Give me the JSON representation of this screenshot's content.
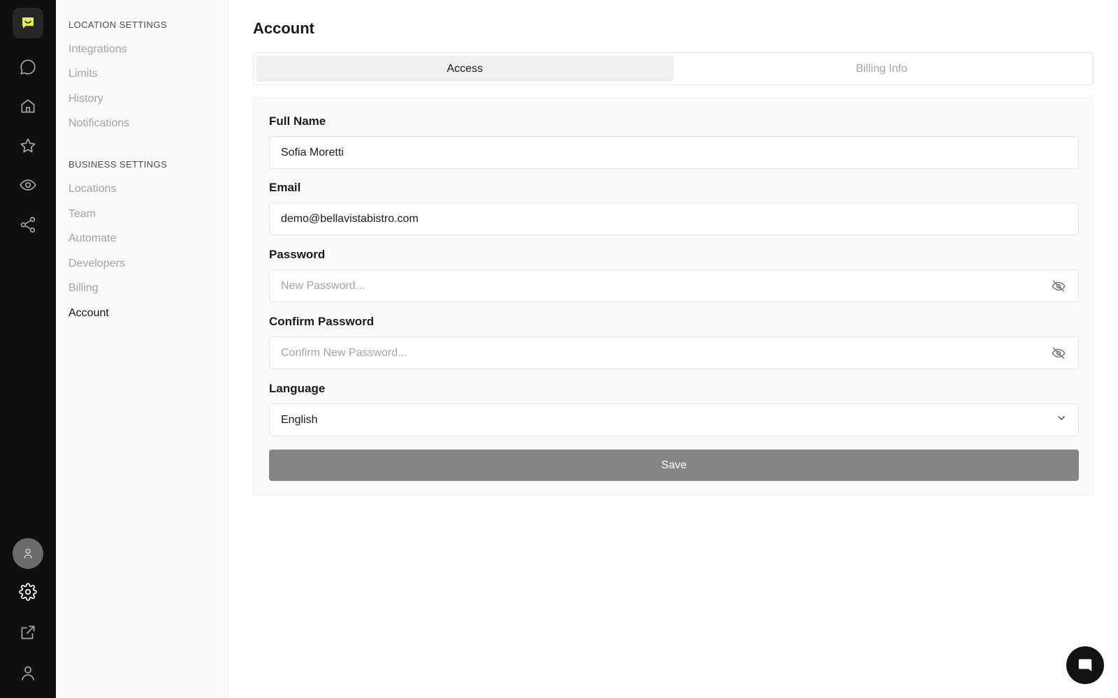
{
  "rail": {
    "items": [
      {
        "icon": "chat-bubble-icon"
      },
      {
        "icon": "home-icon"
      },
      {
        "icon": "star-icon"
      },
      {
        "icon": "eye-icon"
      },
      {
        "icon": "share-icon"
      }
    ],
    "bottom": [
      {
        "icon": "avatar-icon"
      },
      {
        "icon": "gear-icon"
      },
      {
        "icon": "external-link-icon"
      },
      {
        "icon": "user-icon"
      }
    ],
    "brand_color": "#e6f24a"
  },
  "settings_nav": {
    "location_title": "LOCATION SETTINGS",
    "location_items": [
      "Integrations",
      "Limits",
      "History",
      "Notifications"
    ],
    "business_title": "BUSINESS SETTINGS",
    "business_items": [
      "Locations",
      "Team",
      "Automate",
      "Developers",
      "Billing",
      "Account"
    ],
    "active": "Account"
  },
  "main": {
    "title": "Account",
    "tabs": [
      {
        "label": "Access",
        "active": true
      },
      {
        "label": "Billing Info",
        "active": false
      }
    ],
    "form": {
      "full_name_label": "Full Name",
      "full_name_value": "Sofia Moretti",
      "email_label": "Email",
      "email_value": "demo@bellavistabistro.com",
      "password_label": "Password",
      "password_placeholder": "New Password...",
      "confirm_label": "Confirm Password",
      "confirm_placeholder": "Confirm New Password...",
      "language_label": "Language",
      "language_value": "English",
      "save_label": "Save"
    }
  }
}
